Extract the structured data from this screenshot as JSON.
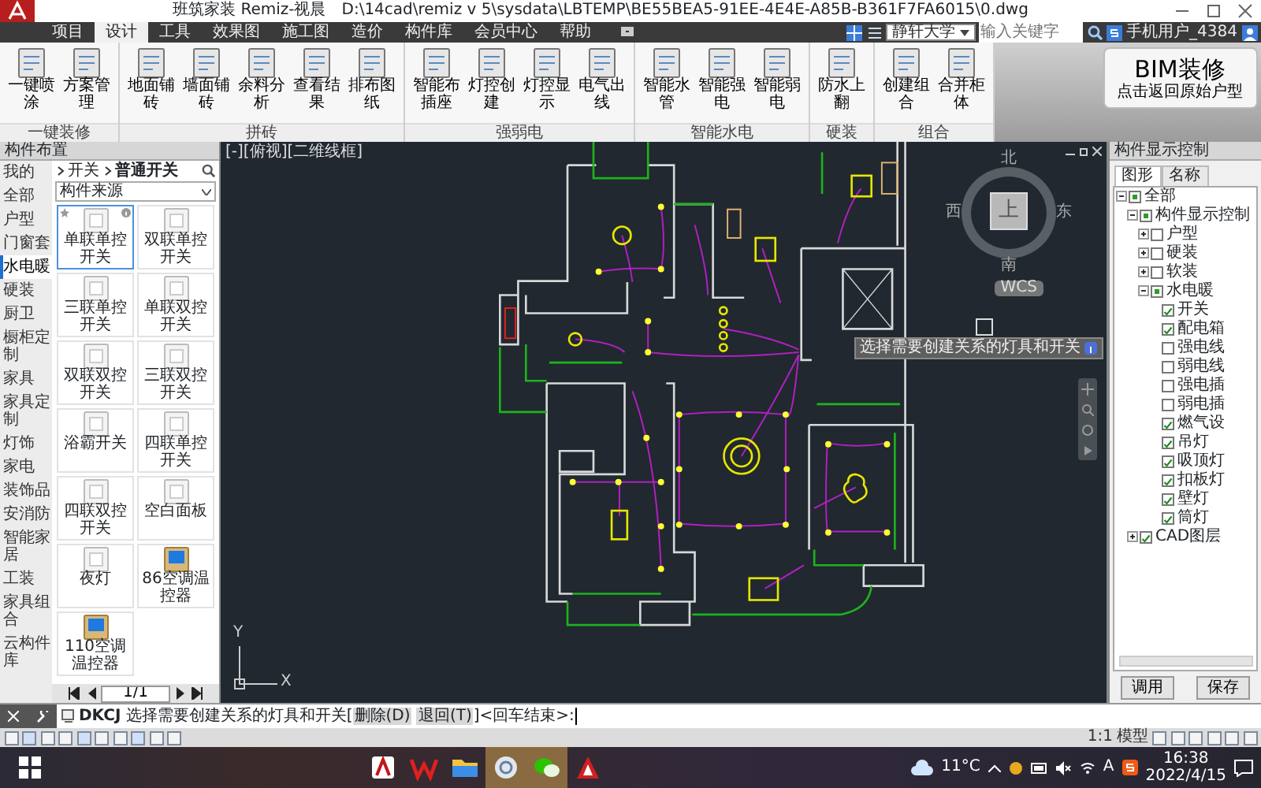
{
  "window": {
    "title": "班筑家装 Remiz-视晨",
    "file_path": "D:\\14cad\\remiz v 5\\sysdata\\LBTEMP\\BE55BEA5-91EE-4E4E-A85B-B361F7FA6015\\0.dwg"
  },
  "menu_tabs": [
    {
      "label": "项目",
      "selected": false
    },
    {
      "label": "设计",
      "selected": true
    },
    {
      "label": "工具",
      "selected": false
    },
    {
      "label": "效果图",
      "selected": false
    },
    {
      "label": "施工图",
      "selected": false
    },
    {
      "label": "造价",
      "selected": false
    },
    {
      "label": "构件库",
      "selected": false
    },
    {
      "label": "会员中心",
      "selected": false
    },
    {
      "label": "帮助",
      "selected": false
    }
  ],
  "menu_right": {
    "font": "静轩大学",
    "search_placeholder": "输入关键字",
    "user": "手机用户_4384"
  },
  "ribbon": {
    "groups": [
      {
        "label": "一键装修",
        "buttons": [
          "一键喷涂",
          "方案管理"
        ]
      },
      {
        "label": "拼砖",
        "buttons": [
          "地面铺砖",
          "墙面铺砖",
          "余料分析",
          "查看结果",
          "排布图纸"
        ]
      },
      {
        "label": "强弱电",
        "buttons": [
          "智能布插座",
          "灯控创建",
          "灯控显示",
          "电气出线"
        ]
      },
      {
        "label": "智能水电",
        "buttons": [
          "智能水管",
          "智能强电",
          "智能弱电"
        ]
      },
      {
        "label": "硬装",
        "buttons": [
          "防水上翻"
        ]
      },
      {
        "label": "组合",
        "buttons": [
          "创建组合",
          "合并柜体"
        ]
      }
    ],
    "bim_button": {
      "title": "BIM装修",
      "subtitle": "点击返回原始户型"
    }
  },
  "left_panel": {
    "title": "构件布置",
    "categories": [
      {
        "label": "我的",
        "selected": false
      },
      {
        "label": "全部",
        "selected": false
      },
      {
        "label": "户型",
        "selected": false
      },
      {
        "label": "门窗套",
        "selected": false
      },
      {
        "label": "水电暖",
        "selected": true
      },
      {
        "label": "硬装",
        "selected": false
      },
      {
        "label": "厨卫",
        "selected": false
      },
      {
        "label": "橱柜定制",
        "selected": false
      },
      {
        "label": "家具",
        "selected": false
      },
      {
        "label": "家具定制",
        "selected": false
      },
      {
        "label": "灯饰",
        "selected": false
      },
      {
        "label": "家电",
        "selected": false
      },
      {
        "label": "装饰品",
        "selected": false
      },
      {
        "label": "安消防",
        "selected": false
      },
      {
        "label": "智能家居",
        "selected": false
      },
      {
        "label": "工装",
        "selected": false
      },
      {
        "label": "家具组合",
        "selected": false
      },
      {
        "label": "云构件库",
        "selected": false
      }
    ],
    "breadcrumb": [
      "开关",
      "普通开关"
    ],
    "source_select": "构件来源",
    "items": [
      {
        "label": "单联单控开关",
        "kind": "switch",
        "selected": true
      },
      {
        "label": "双联单控开关",
        "kind": "switch",
        "selected": false
      },
      {
        "label": "三联单控开关",
        "kind": "switch",
        "selected": false
      },
      {
        "label": "单联双控开关",
        "kind": "switch",
        "selected": false
      },
      {
        "label": "双联双控开关",
        "kind": "switch",
        "selected": false
      },
      {
        "label": "三联双控开关",
        "kind": "switch",
        "selected": false
      },
      {
        "label": "浴霸开关",
        "kind": "switch",
        "selected": false
      },
      {
        "label": "四联单控开关",
        "kind": "switch",
        "selected": false
      },
      {
        "label": "四联双控开关",
        "kind": "switch",
        "selected": false
      },
      {
        "label": "空白面板",
        "kind": "switch",
        "selected": false
      },
      {
        "label": "夜灯",
        "kind": "switch",
        "selected": false
      },
      {
        "label": "86空调温控器",
        "kind": "thermostat",
        "selected": false
      },
      {
        "label": "110空调温控器",
        "kind": "thermostat",
        "selected": false
      }
    ],
    "page": "1/1"
  },
  "viewport": {
    "label": "[-][俯视][二维线框]",
    "viewcube": {
      "north": "北",
      "west": "西",
      "east": "东",
      "south": "南",
      "top": "上"
    },
    "wcs": "WCS",
    "ucs_x": "X",
    "ucs_y": "Y",
    "tooltip": "选择需要创建关系的灯具和开关"
  },
  "right_panel": {
    "title": "构件显示控制",
    "tabs": [
      {
        "label": "图形",
        "selected": true
      },
      {
        "label": "名称",
        "selected": false
      }
    ],
    "tree": [
      {
        "label": "全部",
        "checked": false,
        "indeterminate": true,
        "expanded": true,
        "children": [
          {
            "label": "构件显示控制",
            "checked": false,
            "indeterminate": true,
            "expanded": true,
            "children": [
              {
                "label": "户型",
                "checked": false,
                "indeterminate": false,
                "expanded": false
              },
              {
                "label": "硬装",
                "checked": false,
                "indeterminate": false,
                "expanded": false
              },
              {
                "label": "软装",
                "checked": false,
                "indeterminate": false,
                "expanded": false
              },
              {
                "label": "水电暖",
                "checked": false,
                "indeterminate": true,
                "expanded": true,
                "children": [
                  {
                    "label": "开关",
                    "checked": true,
                    "indeterminate": false
                  },
                  {
                    "label": "配电箱",
                    "checked": true,
                    "indeterminate": false
                  },
                  {
                    "label": "强电线",
                    "checked": false,
                    "indeterminate": false
                  },
                  {
                    "label": "弱电线",
                    "checked": false,
                    "indeterminate": false
                  },
                  {
                    "label": "强电插",
                    "checked": false,
                    "indeterminate": false
                  },
                  {
                    "label": "弱电插",
                    "checked": false,
                    "indeterminate": false
                  },
                  {
                    "label": "燃气设",
                    "checked": true,
                    "indeterminate": false
                  },
                  {
                    "label": "吊灯",
                    "checked": true,
                    "indeterminate": false
                  },
                  {
                    "label": "吸顶灯",
                    "checked": true,
                    "indeterminate": false
                  },
                  {
                    "label": "扣板灯",
                    "checked": true,
                    "indeterminate": false
                  },
                  {
                    "label": "壁灯",
                    "checked": true,
                    "indeterminate": false
                  },
                  {
                    "label": "筒灯",
                    "checked": true,
                    "indeterminate": false
                  }
                ]
              }
            ]
          },
          {
            "label": "CAD图层",
            "checked": true,
            "indeterminate": false,
            "expanded": false
          }
        ]
      }
    ],
    "buttons": [
      "调用",
      "保存"
    ]
  },
  "command_line": {
    "command": "DKCJ",
    "prompt": "选择需要创建关系的灯具和开关[",
    "options": [
      "删除(D)",
      "退回(T)"
    ],
    "suffix": "]<回车结束>:"
  },
  "status_bar": {
    "scale": "1:1",
    "space": "模型"
  },
  "taskbar": {
    "weather": "11°C",
    "input_indicator": "A",
    "time": "16:38",
    "date": "2022/4/15"
  }
}
